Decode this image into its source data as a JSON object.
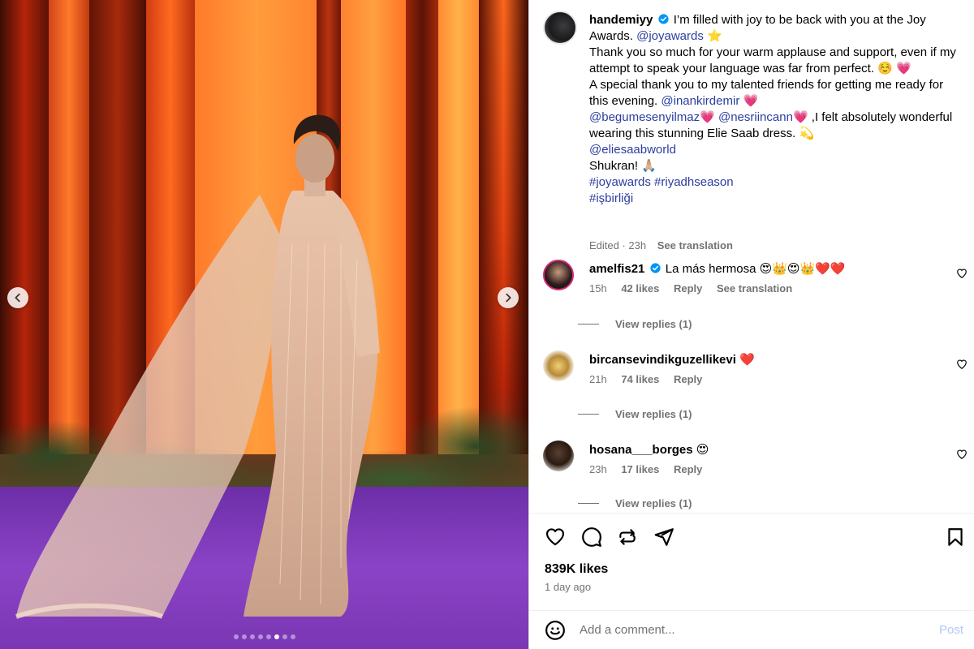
{
  "photo": {
    "slide_count": 8,
    "active_slide": 5,
    "prev_icon": "chevron-left-icon",
    "next_icon": "chevron-right-icon"
  },
  "post": {
    "author": "handemiyy",
    "verified": true,
    "caption": {
      "line1": " I’m filled with joy to be back with you at the Joy Awards. ",
      "mention_joyawards": "@joyawards",
      "star": " ⭐",
      "line2": "Thank you so much for your warm applause and support, even if my attempt to speak your language was far from perfect. ☺️ 💗",
      "line3_a": "A special thank you to my talented friends for getting me ready for this evening. ",
      "mention_inankirdemir": "@inankirdemir",
      "heart1": " 💗 ",
      "mention_begumesenyilmaz": "@begumesenyilmaz",
      "heart2": "💗 ",
      "mention_nesriincann": "@nesriincann",
      "line3_b": "💗 ,I felt absolutely wonderful wearing this stunning Elie Saab dress. 💫",
      "mention_eliesaabworld": "@eliesaabworld",
      "shukran": "Shukran! 🙏🏼",
      "hashtags_line1": "#joyawards #riyadhseason",
      "hashtags_line2": "#işbirliği"
    },
    "meta": {
      "edited": "Edited · 23h",
      "see_translation": "See translation"
    },
    "likes": "839K likes",
    "posted_ago": "1 day ago"
  },
  "comments": [
    {
      "username": "amelfis21",
      "verified": true,
      "text": "La más hermosa 😍👑😍👑❤️❤️",
      "time": "15h",
      "likes": "42 likes",
      "reply": "Reply",
      "see_translation": "See translation",
      "view_replies": "View replies (1)"
    },
    {
      "username": "bircansevindikguzellikevi",
      "verified": false,
      "text": "❤️",
      "time": "21h",
      "likes": "74 likes",
      "reply": "Reply",
      "view_replies": "View replies (1)"
    },
    {
      "username": "hosana___borges",
      "verified": false,
      "text": "😍",
      "time": "23h",
      "likes": "17 likes",
      "reply": "Reply",
      "view_replies": "View replies (1)"
    }
  ],
  "comment_box": {
    "placeholder": "Add a comment...",
    "post_label": "Post"
  },
  "colors": {
    "link": "#2c3e9e",
    "secondary_text": "#737373",
    "post_button_disabled": "#b3c9f5",
    "verified_badge": "#0095f6"
  }
}
